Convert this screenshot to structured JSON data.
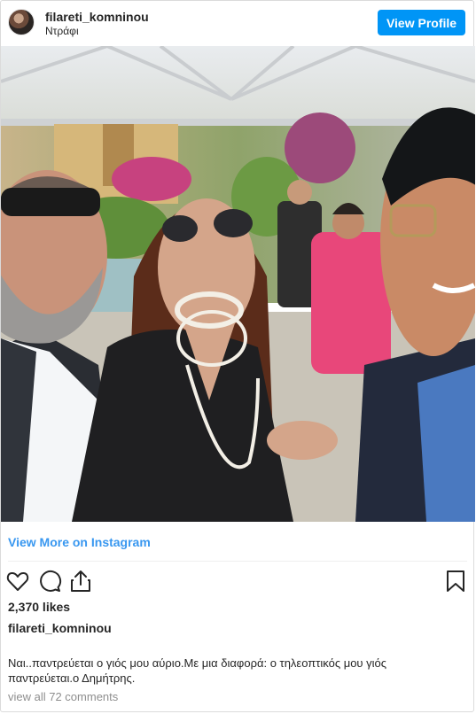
{
  "header": {
    "username": "filareti_komninou",
    "location": "Ντράφι",
    "view_profile_label": "View Profile"
  },
  "photo": {
    "icon": "photo-selfie"
  },
  "view_more_label": "View More on Instagram",
  "actions": {
    "like_icon": "heart-icon",
    "comment_icon": "comment-icon",
    "share_icon": "share-icon",
    "save_icon": "bookmark-icon"
  },
  "likes_text": "2,370 likes",
  "caption": {
    "username": "filareti_komninou",
    "line1": "Ναι..παντρεύεται ο γιός μου αύριο.Με μια διαφορά: ο τηλεοπτικός μου γιός",
    "line2": "παντρεύεται.ο Δημήτρης."
  },
  "comments_text": "view all 72 comments",
  "colors": {
    "accent": "#0095f6",
    "link": "#3897f0",
    "muted": "#8e8e8e"
  }
}
